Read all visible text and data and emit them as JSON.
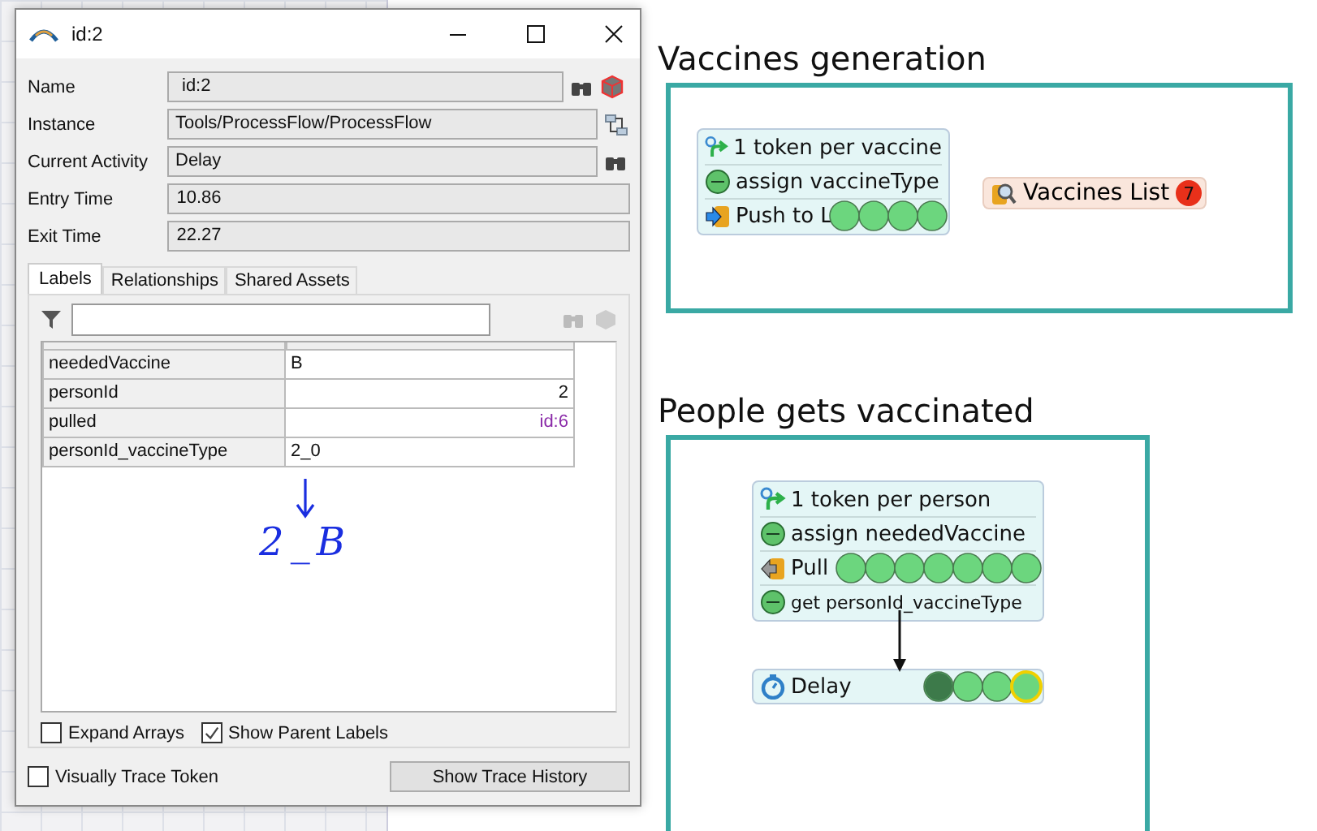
{
  "dialog": {
    "title": "id:2",
    "fields": [
      {
        "label": "Name",
        "value": "id:2",
        "kind": "name"
      },
      {
        "label": "Instance",
        "value": "Tools/ProcessFlow/ProcessFlow",
        "kind": "instance"
      },
      {
        "label": "Current Activity",
        "value": "Delay",
        "kind": "activity"
      },
      {
        "label": "Entry Time",
        "value": "10.86",
        "kind": "plain"
      },
      {
        "label": "Exit Time",
        "value": "22.27",
        "kind": "plain"
      }
    ],
    "tabs": [
      {
        "label": "Labels",
        "selected": true
      },
      {
        "label": "Relationships",
        "selected": false
      },
      {
        "label": "Shared Assets",
        "selected": false
      }
    ],
    "labels": [
      {
        "name": "neededVaccine",
        "value": "B",
        "kind": "text"
      },
      {
        "name": "personId",
        "value": "2",
        "kind": "number"
      },
      {
        "name": "pulled",
        "value": "id:6",
        "kind": "pointer"
      },
      {
        "name": "personId_vaccineType",
        "value": "2_0",
        "kind": "text"
      }
    ],
    "annotation": "2_B",
    "options": [
      {
        "label": "Expand Arrays",
        "checked": false
      },
      {
        "label": "Show Parent Labels",
        "checked": true
      }
    ],
    "trace": {
      "label": "Visually Trace Token",
      "checked": false
    },
    "button": "Show Trace History"
  },
  "flows": [
    {
      "title": "Vaccines generation",
      "kind": "top",
      "blocks": [
        {
          "kind": "stack",
          "rows": [
            {
              "kind": "source",
              "text": "1 token per vaccine",
              "tokens": []
            },
            {
              "kind": "assign",
              "text": "assign vaccineType",
              "tokens": []
            },
            {
              "kind": "push",
              "text": "Push to L",
              "tokens": [
                {
                  "kind": "full",
                  "selected": false
                },
                {
                  "kind": "full",
                  "selected": false
                },
                {
                  "kind": "full",
                  "selected": false
                },
                {
                  "kind": "full",
                  "selected": false
                }
              ]
            }
          ]
        },
        {
          "kind": "list",
          "text": "Vaccines List",
          "count": "7"
        }
      ]
    },
    {
      "title": "People gets vaccinated",
      "kind": "bottom",
      "blocks": [
        {
          "kind": "stack",
          "rows": [
            {
              "kind": "source",
              "text": "1 token per person",
              "tokens": []
            },
            {
              "kind": "assign",
              "text": "assign neededVaccine",
              "tokens": []
            },
            {
              "kind": "pull",
              "text": "Pull",
              "tokens": [
                {
                  "kind": "full",
                  "selected": false
                },
                {
                  "kind": "full",
                  "selected": false
                },
                {
                  "kind": "full",
                  "selected": false
                },
                {
                  "kind": "full",
                  "selected": false
                },
                {
                  "kind": "full",
                  "selected": false
                },
                {
                  "kind": "full",
                  "selected": false
                },
                {
                  "kind": "full",
                  "selected": false
                }
              ]
            },
            {
              "kind": "assign-small",
              "text": "get personId_vaccineType",
              "tokens": []
            }
          ]
        },
        {
          "kind": "single",
          "rows": [
            {
              "kind": "delay",
              "text": "Delay",
              "tokens": [
                {
                  "kind": "half",
                  "selected": false
                },
                {
                  "kind": "full",
                  "selected": false
                },
                {
                  "kind": "full",
                  "selected": false
                },
                {
                  "kind": "full",
                  "selected": true
                }
              ]
            }
          ]
        }
      ]
    }
  ]
}
